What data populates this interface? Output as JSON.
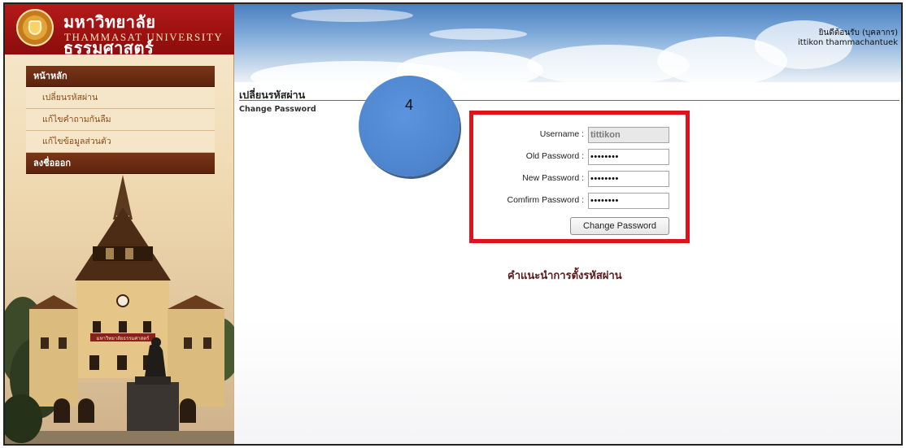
{
  "header": {
    "brand_thai": "มหาวิทยาลัยธรรมศาสตร์",
    "brand_english": "THAMMASAT UNIVERSITY",
    "welcome_text": "ยินดีต้อนรับ (บุคลากร)",
    "user_name": "ittikon thammachantuek"
  },
  "sidebar": {
    "home_label": "หน้าหลัก",
    "items": [
      {
        "label": "เปลี่ยนรหัสผ่าน"
      },
      {
        "label": "แก้ไขคำถามกันลืม"
      },
      {
        "label": "แก้ไขข้อมูลส่วนตัว"
      }
    ],
    "logout_label": "ลงชื่อออก",
    "building_sign": "มหาวิทยาลัยธรรมศาสตร์"
  },
  "main": {
    "page_title": "เปลี่ยนรหัสผ่าน",
    "page_subtitle": "Change Password",
    "step_badge": "4",
    "form": {
      "username_label": "Username :",
      "username_value": "tittikon",
      "old_password_label": "Old Password :",
      "old_password_value": "••••••••",
      "new_password_label": "New Password :",
      "new_password_value": "••••••••",
      "confirm_password_label": "Comfirm Password :",
      "confirm_password_value": "••••••••",
      "submit_label": "Change Password"
    },
    "advice_heading": "คำแนะนำการตั้งรหัสผ่าน"
  },
  "colors": {
    "brand_red": "#9c1111",
    "menu_brown": "#5c240d",
    "highlight_red": "#e0121a",
    "badge_blue": "#4f87d0"
  }
}
